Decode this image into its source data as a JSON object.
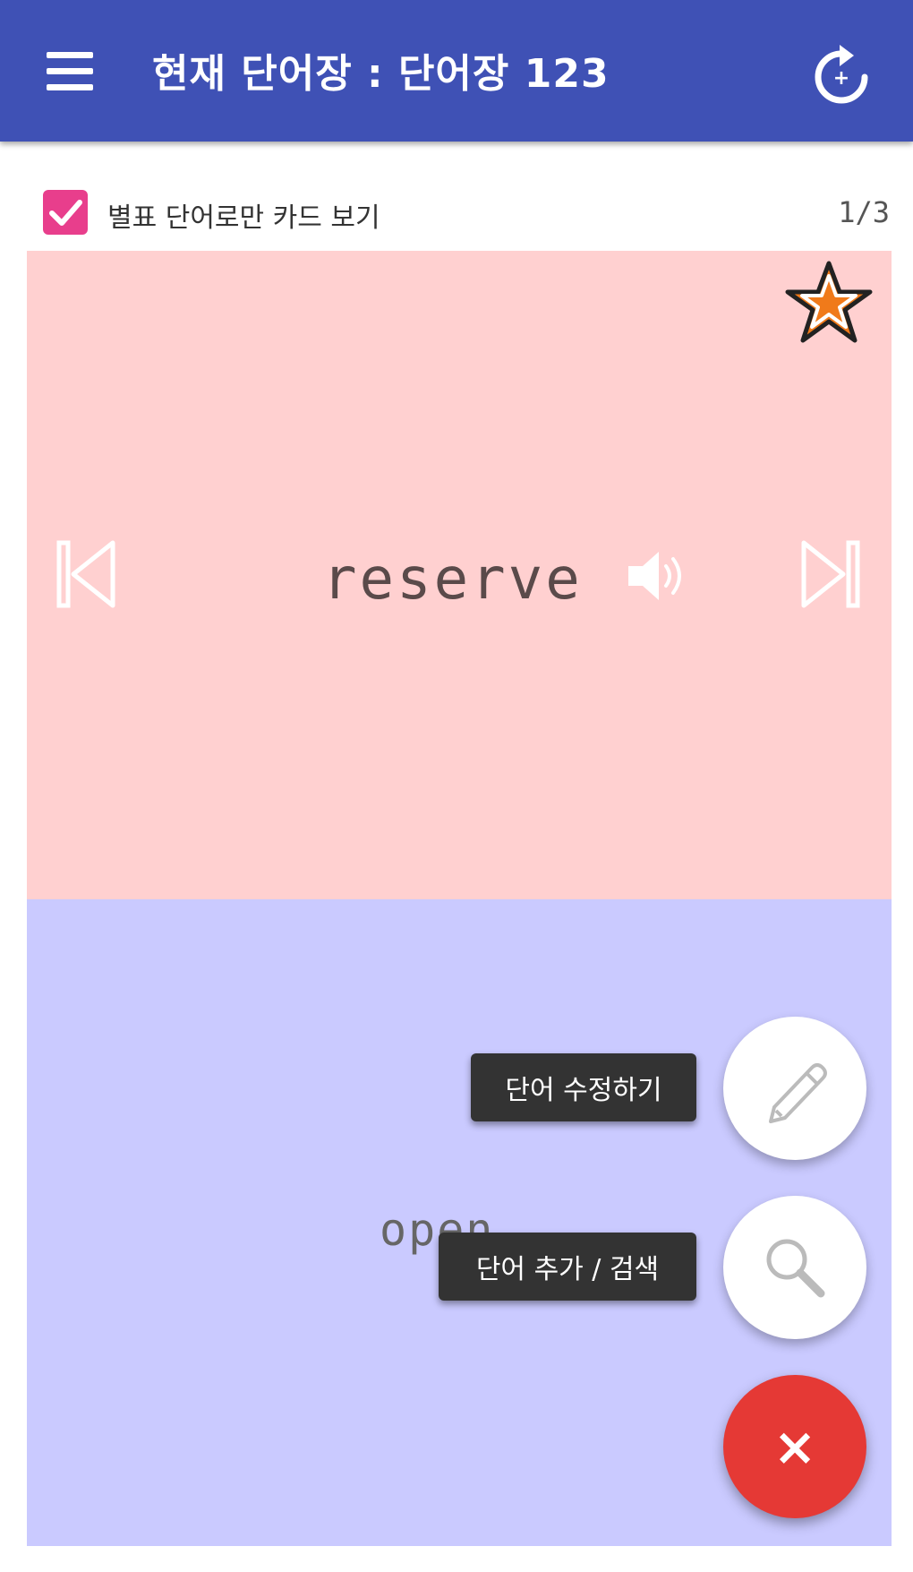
{
  "appbar": {
    "title": "현재 단어장 : 단어장 123",
    "color": "#3f51b5",
    "menu_icon": "hamburger-menu-icon",
    "refresh_icon": "refresh-icon"
  },
  "filter": {
    "checked": true,
    "label": "별표 단어로만 카드 보기",
    "counter": "1/3",
    "checkbox_color": "#e83e8c"
  },
  "card": {
    "word": "reserve",
    "meaning": "open",
    "front_color": "#ffd0d0",
    "back_color": "#cacaff",
    "starred": true,
    "star_icon": "star-icon",
    "speaker_icon": "speaker-icon",
    "prev_icon": "skip-previous-icon",
    "next_icon": "skip-next-icon"
  },
  "fab": {
    "edit_label": "단어 수정하기",
    "edit_icon": "pencil-icon",
    "search_label": "단어 추가 / 검색",
    "search_icon": "magnifier-icon",
    "close_label": "×",
    "close_color": "#e53935"
  }
}
